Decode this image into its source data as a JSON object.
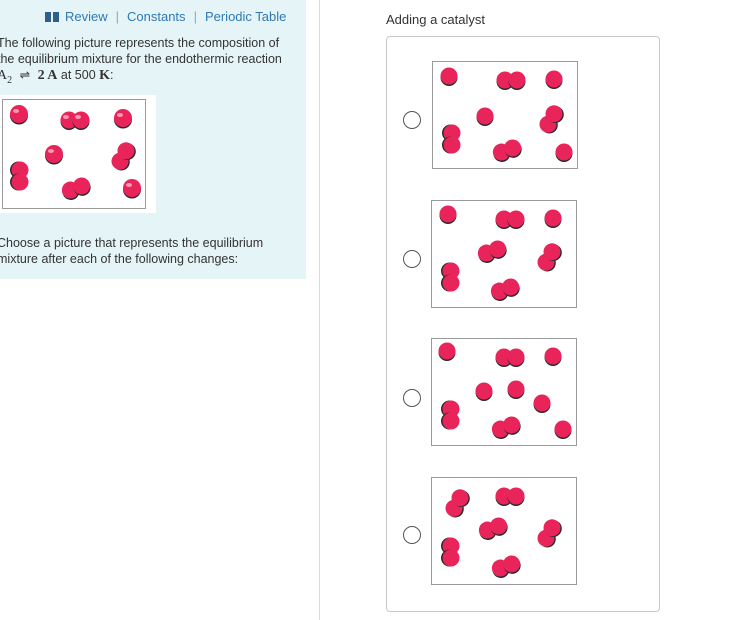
{
  "colors": {
    "link": "#2f79b5",
    "panel_bg": "#e5f4f6",
    "molecule": "#e8245a",
    "molecule_shadow": "#2a2a2a"
  },
  "toplinks": {
    "icon": "book-icon",
    "review": "Review",
    "constants": "Constants",
    "periodic_table": "Periodic Table",
    "separator": "|"
  },
  "intro": {
    "line1": "The following picture represents the composition of",
    "line2": "the equilibrium mixture for the endothermic reaction",
    "reactant": "A",
    "reactant_sub": "2",
    "arrow": "⇌",
    "product": "2 A",
    "at_text": "at 500",
    "unit": "K",
    "colon": ":"
  },
  "question": {
    "line1": "Choose a picture that represents the equilibrium",
    "line2": "mixture after each of the following changes:"
  },
  "part": {
    "title": "Adding a catalyst"
  },
  "options": [
    {
      "id": "option-1",
      "selected": false
    },
    {
      "id": "option-2",
      "selected": false
    },
    {
      "id": "option-3",
      "selected": false
    },
    {
      "id": "option-4",
      "selected": false
    }
  ]
}
